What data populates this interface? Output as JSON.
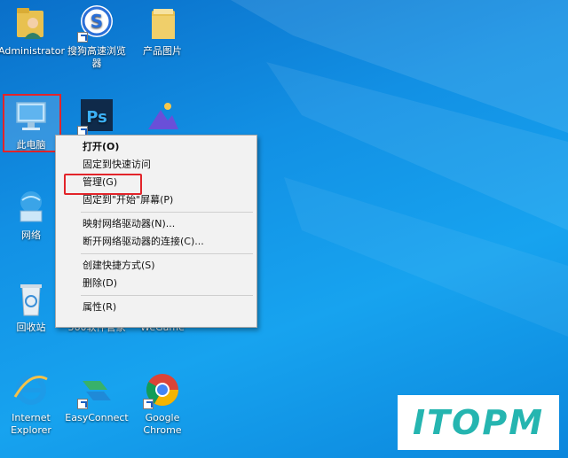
{
  "desktop": {
    "icons": [
      {
        "name": "administrator-folder",
        "label": "Administrator"
      },
      {
        "name": "sogou-browser",
        "label": "搜狗高速浏览器"
      },
      {
        "name": "product-images-folder",
        "label": "产品图片"
      },
      {
        "name": "this-pc",
        "label": "此电脑"
      },
      {
        "name": "photoshop",
        "label": "Ps"
      },
      {
        "name": "network",
        "label": "网络"
      },
      {
        "name": "recycle-bin",
        "label": "回收站"
      },
      {
        "name": "software-manager",
        "label": "360软件管家"
      },
      {
        "name": "wegame",
        "label": "WeGame"
      },
      {
        "name": "internet-explorer",
        "label": "Internet Explorer"
      },
      {
        "name": "easyconnect",
        "label": "EasyConnect"
      },
      {
        "name": "google-chrome",
        "label": "Google Chrome"
      }
    ]
  },
  "context_menu": {
    "items": [
      {
        "label": "打开(O)",
        "bold": true
      },
      {
        "label": "固定到快速访问"
      },
      {
        "label": "管理(G)"
      },
      {
        "label": "固定到\"开始\"屏幕(P)"
      },
      {
        "label": "映射网络驱动器(N)..."
      },
      {
        "label": "断开网络驱动器的连接(C)..."
      },
      {
        "label": "创建快捷方式(S)"
      },
      {
        "label": "删除(D)"
      },
      {
        "label": "属性(R)"
      }
    ]
  },
  "watermark": {
    "text": "ITOPM",
    "color": "#25b5b0"
  },
  "colors": {
    "desktop": "#1290e4",
    "highlight": "#e2242a"
  }
}
